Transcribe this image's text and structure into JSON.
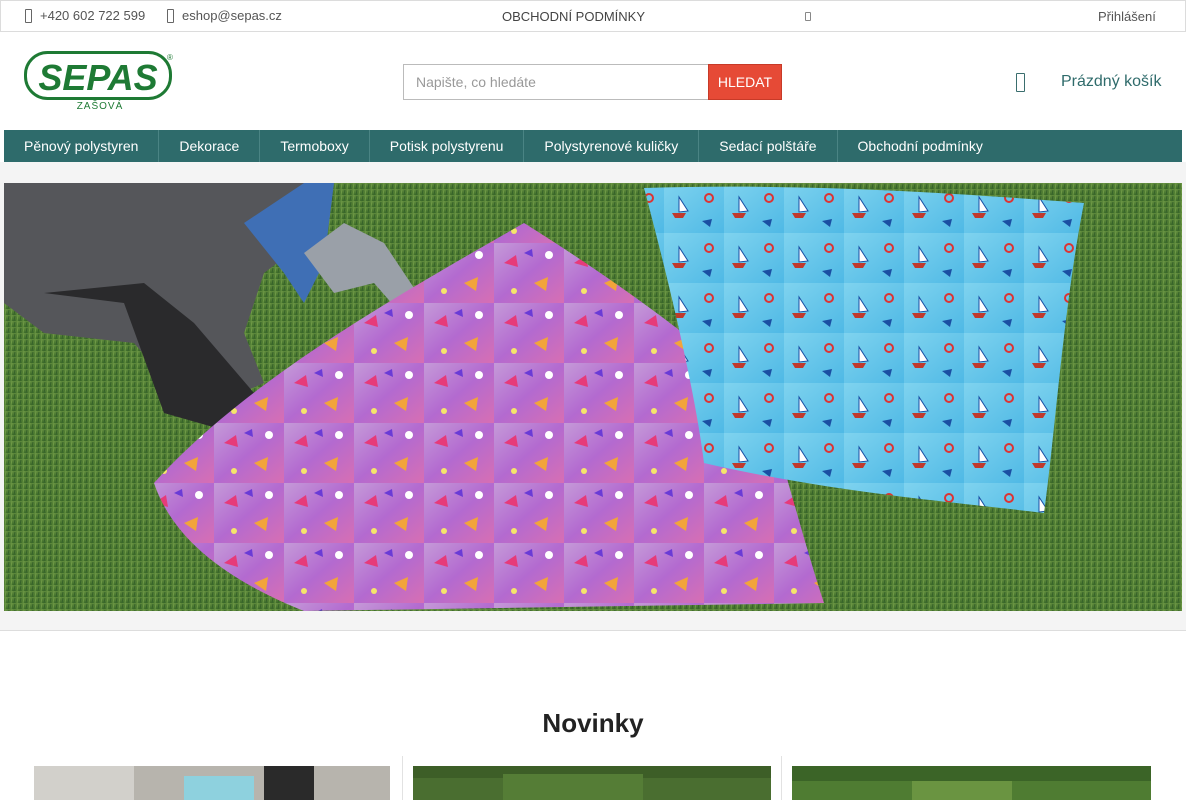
{
  "topbar": {
    "phone": "+420 602 722 599",
    "email": "eshop@sepas.cz",
    "terms_link": "OBCHODNÍ PODMÍNKY",
    "login": "Přihlášení"
  },
  "brand": {
    "logo_text": "SEPAS",
    "logo_subtext": "ZAŠOVÁ",
    "logo_mark": "®",
    "color": "#1e7a34"
  },
  "search": {
    "placeholder": "Napište, co hledáte",
    "button_label": "HLEDAT"
  },
  "cart": {
    "icon": "cart-icon",
    "label": "Prázdný košík"
  },
  "nav": {
    "items": [
      {
        "label": "Pěnový polystyren"
      },
      {
        "label": "Dekorace"
      },
      {
        "label": "Termoboxy"
      },
      {
        "label": "Potisk polystyrenu"
      },
      {
        "label": "Polystyrenové kuličky"
      },
      {
        "label": "Sedací polštáře"
      },
      {
        "label": "Obchodní podmínky"
      }
    ]
  },
  "colors": {
    "nav_bg": "#2e6b6b",
    "accent": "#e64a36"
  },
  "novinky": {
    "title": "Novinky"
  }
}
